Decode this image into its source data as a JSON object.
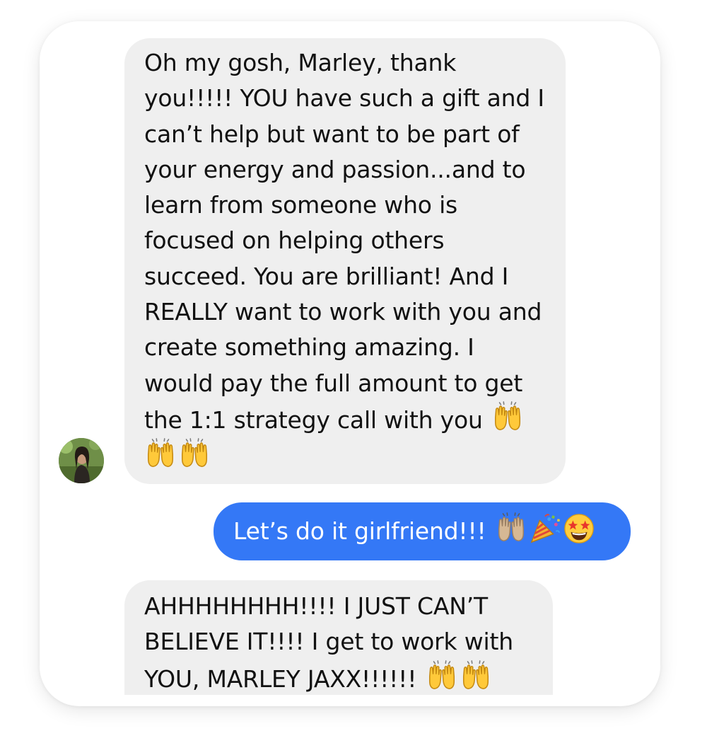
{
  "conversation": {
    "messages": [
      {
        "direction": "incoming",
        "text": "Oh my gosh, Marley, thank you!!!!! YOU have such a gift and I can’t help but want to be part of your energy and passion...and to learn from someone who is focused on helping others succeed. You are brilliant! And I REALLY want to work with you and create something amazing. I would pay the full amount to get the 1:1 strategy call with you",
        "emoji": [
          "raising-hands-emoji",
          "raising-hands-emoji",
          "raising-hands-emoji"
        ]
      },
      {
        "direction": "outgoing",
        "text": "Let’s do it girlfriend!!!",
        "emoji": [
          "raising-hands-emoji",
          "party-popper-emoji",
          "star-struck-emoji"
        ]
      },
      {
        "direction": "incoming",
        "text": "AHHHHHHHH!!!! I JUST CAN’T BELIEVE IT!!!! I get to work with YOU, MARLEY JAXX!!!!!!",
        "emoji": [
          "raising-hands-emoji",
          "raising-hands-emoji"
        ]
      }
    ],
    "avatar": "contact-avatar"
  },
  "colors": {
    "incoming_bubble": "#efefef",
    "outgoing_bubble": "#3478f6",
    "incoming_text": "#111111",
    "outgoing_text": "#ffffff"
  }
}
